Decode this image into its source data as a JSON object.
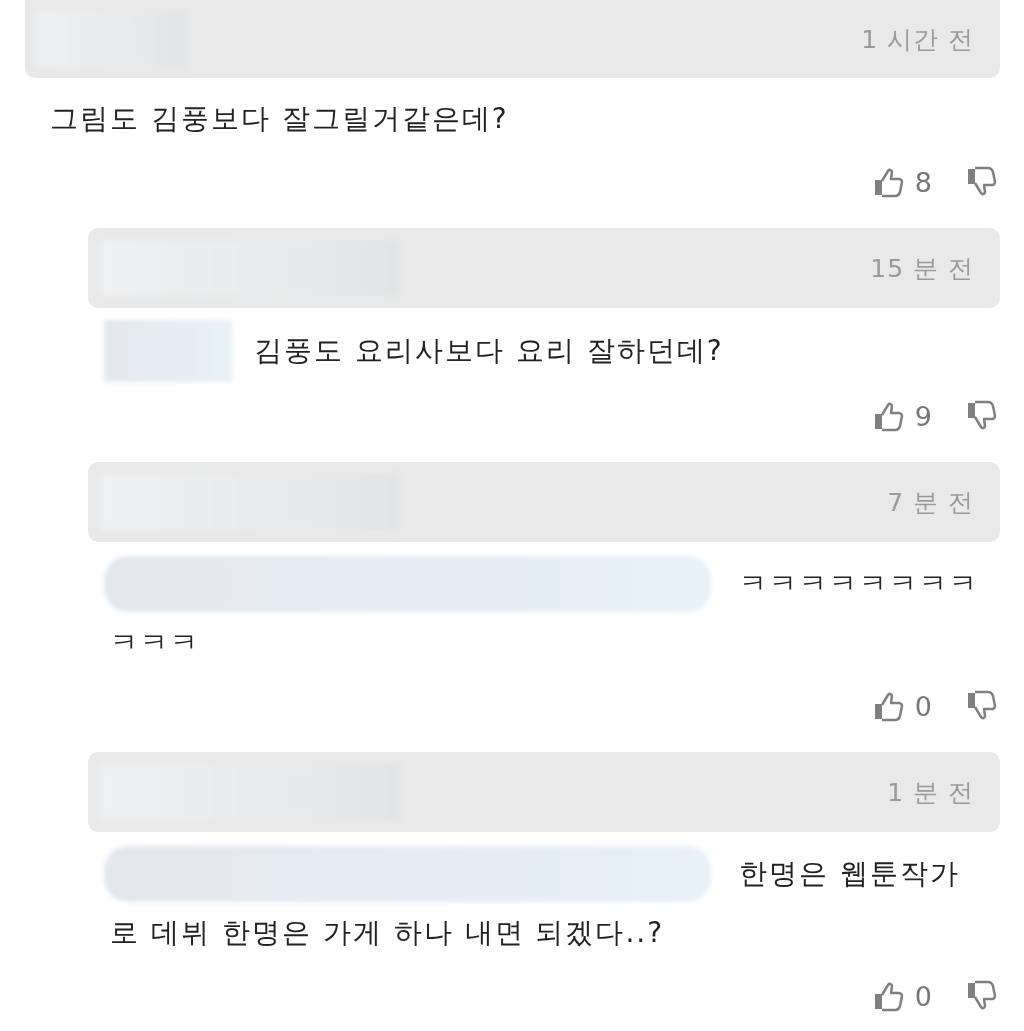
{
  "comments": [
    {
      "kind": "comment",
      "time": "1 시간 전",
      "mention_hidden": false,
      "text": "그림도 김풍보다 잘그릴거같은데?",
      "likes": "8"
    },
    {
      "kind": "reply",
      "time": "15 분 전",
      "mention_hidden": true,
      "text": "김풍도 요리사보다 요리 잘하던데?",
      "likes": "9"
    },
    {
      "kind": "reply",
      "time": "7 분 전",
      "mention_hidden": true,
      "text": "ㅋㅋㅋㅋㅋㅋㅋㅋㅋㅋㅋ",
      "likes": "0"
    },
    {
      "kind": "reply",
      "time": "1 분 전",
      "mention_hidden": true,
      "text": "한명은 웹툰작가로 데뷔 한명은 가게 하나 내면 되겠다..?",
      "likes": "0"
    }
  ]
}
